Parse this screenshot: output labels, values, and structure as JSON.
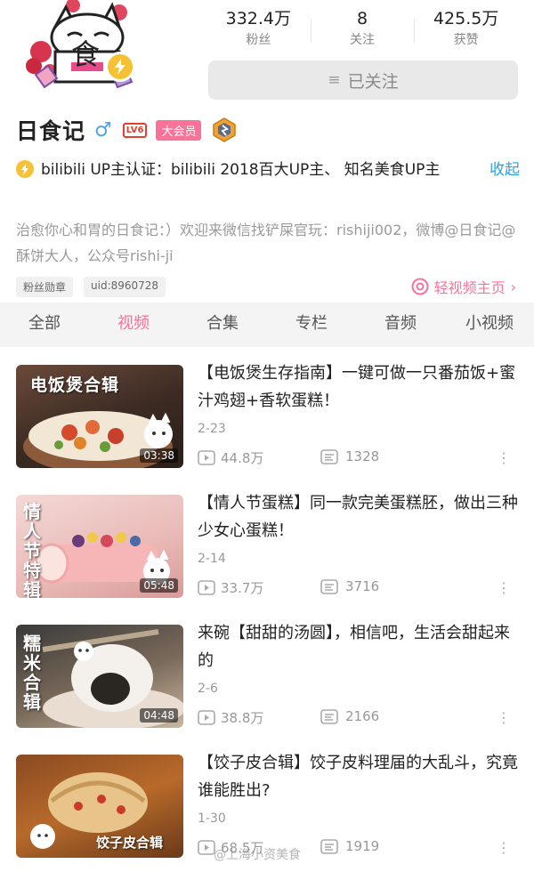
{
  "profile": {
    "name": "日食记",
    "level": "LV6",
    "vip": "大会员",
    "stats": [
      {
        "value": "332.4万",
        "label": "粉丝"
      },
      {
        "value": "8",
        "label": "关注"
      },
      {
        "value": "425.5万",
        "label": "获赞"
      }
    ],
    "follow_label": "已关注",
    "certification": "bilibili UP主认证：bilibili 2018百大UP主、 知名美食UP主",
    "collapse_label": "收起",
    "bio": "治愈你心和胃的日食记：）欢迎来微信找铲屎官玩：rishiji002，微博@日食记@酥饼大人，公众号rishi-ji",
    "tags": [
      "粉丝勋章",
      "uid:8960728"
    ],
    "short_video_label": "轻视频主页",
    "avatar_text": "食"
  },
  "tabs": [
    "全部",
    "视频",
    "合集",
    "专栏",
    "音频",
    "小视频"
  ],
  "active_tab": 1,
  "videos": [
    {
      "title": "【电饭煲生存指南】一键可做一只番茄饭+蜜汁鸡翅+香软蛋糕！",
      "thumb_caption": "电饭煲合辑",
      "duration": "03:38",
      "date": "2-23",
      "views": "44.8万",
      "danmaku": "1328"
    },
    {
      "title": "【情人节蛋糕】同一款完美蛋糕胚，做出三种少女心蛋糕！",
      "thumb_caption": "情人节特辑",
      "duration": "05:48",
      "date": "2-14",
      "views": "33.7万",
      "danmaku": "3716"
    },
    {
      "title": "来碗【甜甜的汤圆】，相信吧，生活会甜起来的",
      "thumb_caption": "糯米合辑",
      "duration": "04:48",
      "date": "2-6",
      "views": "38.8万",
      "danmaku": "2166"
    },
    {
      "title": "【饺子皮合辑】饺子皮料理届的大乱斗，究竟谁能胜出?",
      "thumb_caption": "饺子皮合辑",
      "duration": "",
      "date": "1-30",
      "views": "68.5万",
      "danmaku": "1919"
    }
  ],
  "watermark": "@上海小资美食",
  "colors": {
    "accent_pink": "#fb7299",
    "link_blue": "#2d9fd9",
    "cert_gold": "#f6c233"
  }
}
